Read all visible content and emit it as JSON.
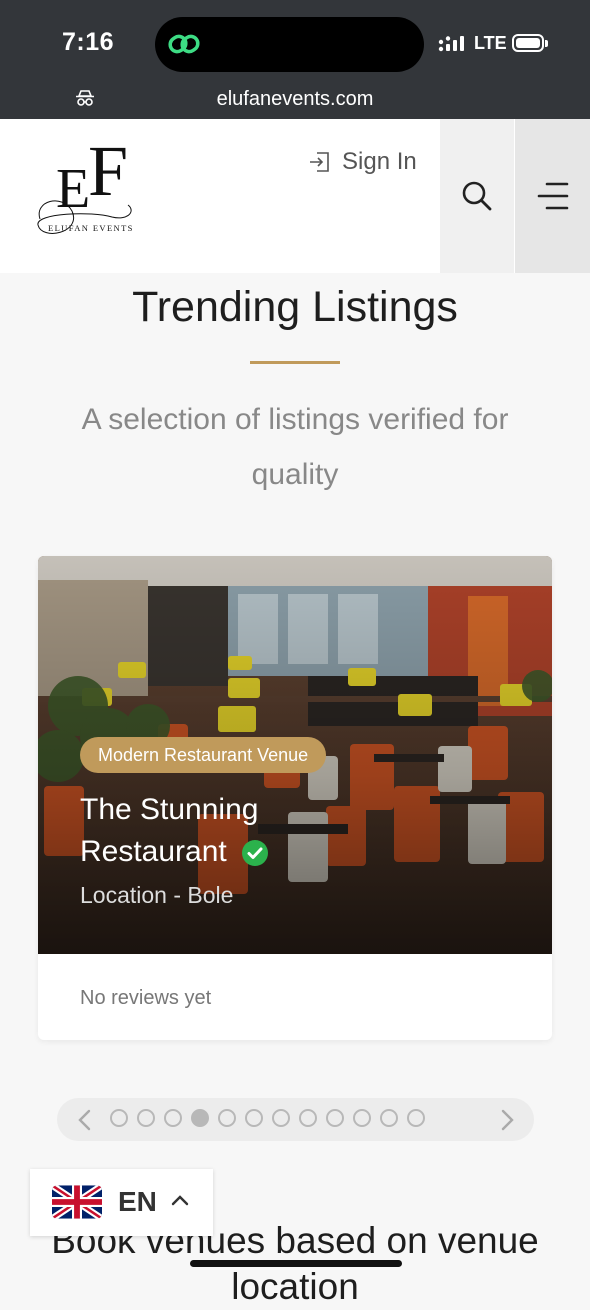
{
  "status_bar": {
    "time": "7:16",
    "network": "LTE"
  },
  "browser": {
    "url": "elufanevents.com",
    "site_icon": "incognito-icon"
  },
  "header": {
    "logo_text": "EF",
    "logo_subtext": "ELUFAN EVENTS",
    "sign_in_label": "Sign In",
    "search_icon": "search-icon",
    "menu_icon": "menu-icon"
  },
  "section": {
    "title": "Trending Listings",
    "subtitle": "A selection of listings verified for quality",
    "accent_color": "#c09a5b"
  },
  "listing": {
    "category": "Modern Restaurant Venue",
    "name": "The Stunning Restaurant",
    "verified": true,
    "location": "Location - Bole",
    "reviews": "No reviews yet"
  },
  "pagination": {
    "total": 12,
    "active_index": 3
  },
  "next_section": {
    "title": "Book venues based on venue location"
  },
  "language": {
    "code": "EN",
    "flag": "uk-flag-icon"
  }
}
